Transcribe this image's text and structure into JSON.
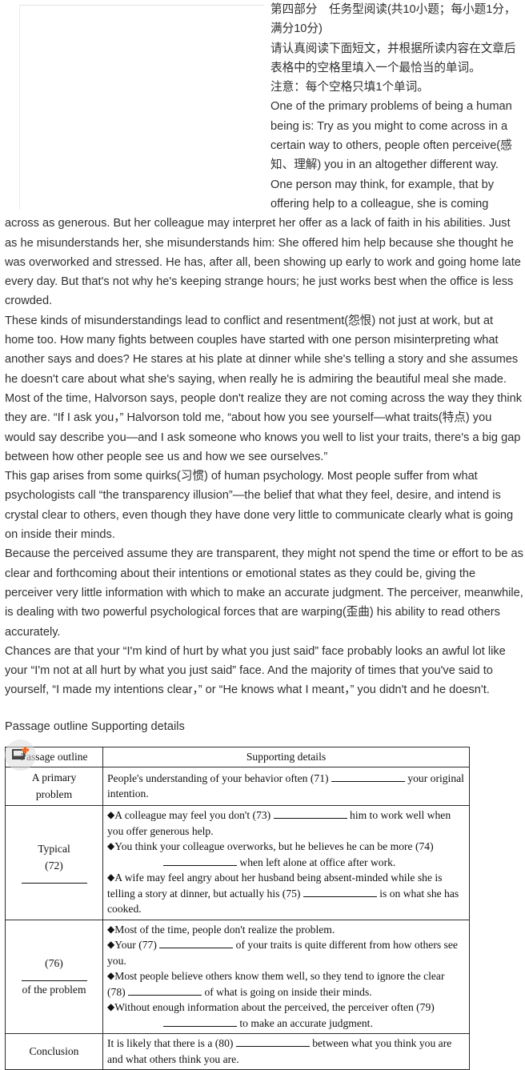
{
  "article": {
    "paragraphs": [
      "第四部分　任务型阅读(共10小题；每小题1分，满分10分)",
      "请认真阅读下面短文，并根据所读内容在文章后表格中的空格里填入一个最恰当的单词。",
      "注意：每个空格只填1个单词。",
      "One of the primary problems of being a human being is: Try as you might to come across in a certain way to others, people often perceive(感知、理解) you in an altogether different way.",
      "One person may think, for example, that by offering help to a colleague, she is coming across as generous. But her colleague may interpret her offer as a lack of faith in his abilities. Just as he misunderstands her, she misunderstands him: She offered him help because she thought he was overworked and stressed. He has, after all, been showing up early to work and going home late every day. But that's not why he's keeping strange hours; he just works best when the office is less crowded.",
      "These kinds of misunderstandings lead to conflict and resentment(怨恨) not just at work, but at home too. How many fights between couples have started with one person misinterpreting what another says and does? He stares at his plate at dinner while she's telling a story and she assumes he doesn't care about what she's saying, when really he is admiring the beautiful meal she made.",
      "Most of the time, Halvorson says, people don't realize they are not coming across the way they think they are. “If I ask you，” Halvorson told me, “about how you see yourself—what traits(特点) you would say describe you—and I ask someone who knows you well to list your traits, there's a big gap between how other people see us and how we see ourselves.”",
      "This gap arises from some quirks(习惯) of human psychology. Most people suffer from what psychologists call “the transparency illusion”—the belief that what they feel, desire, and intend is crystal clear to others, even though they have done very little to communicate clearly what is going on inside their minds.",
      "Because the perceived assume they are transparent, they might not spend the time or effort to be as clear and forthcoming about their intentions or emotional states as they could be, giving the perceiver very little information with which to make an accurate judgment. The perceiver, meanwhile, is dealing with two powerful psychological forces that are warping(歪曲) his ability to read others accurately.",
      "Chances are that your “I'm kind of hurt by what you just said” face probably looks an awful lot like your “I'm not at all hurt by what you just said” face. And the majority of times that you've said to yourself, “I made my intentions clear，” or “He knows what I meant，” you didn't and he doesn't."
    ],
    "caption": "Passage outline Supporting details"
  },
  "table": {
    "headers": [
      "Passage outline",
      "Supporting details"
    ],
    "rows": [
      {
        "outline_lines": [
          "A primary",
          "problem"
        ],
        "outline_blank": false,
        "details": [
          {
            "bullet": false,
            "segments": [
              {
                "type": "text",
                "value": "People's understanding of your behavior often (71)"
              },
              {
                "type": "blank",
                "width": "w1"
              },
              {
                "type": "text",
                "value": "your original intention."
              }
            ]
          }
        ]
      },
      {
        "outline_lines": [
          "Typical",
          "(72)"
        ],
        "outline_blank": true,
        "details": [
          {
            "bullet": true,
            "segments": [
              {
                "type": "text",
                "value": "A colleague may feel you don't (73)"
              },
              {
                "type": "blank",
                "width": "w1"
              },
              {
                "type": "text",
                "value": "him to work well when you offer generous help."
              }
            ]
          },
          {
            "bullet": true,
            "segments": [
              {
                "type": "text",
                "value": "You think your colleague overworks, but he believes he can be more (74)"
              },
              {
                "type": "indent",
                "value": ""
              },
              {
                "type": "blank",
                "width": "w1"
              },
              {
                "type": "text",
                "value": "when left alone at office after work."
              }
            ]
          },
          {
            "bullet": true,
            "segments": [
              {
                "type": "text",
                "value": "A wife may feel angry about her husband being absent-minded while she is telling a story at dinner, but actually his (75)"
              },
              {
                "type": "blank",
                "width": "w1"
              },
              {
                "type": "text",
                "value": "is on what she has cooked."
              }
            ]
          }
        ]
      },
      {
        "outline_lines": [
          "(76)",
          "of the problem"
        ],
        "outline_blank": true,
        "details": [
          {
            "bullet": true,
            "segments": [
              {
                "type": "text",
                "value": "Most of the time, people don't realize the problem."
              }
            ]
          },
          {
            "bullet": true,
            "segments": [
              {
                "type": "text",
                "value": "Your (77)"
              },
              {
                "type": "blank",
                "width": "w1"
              },
              {
                "type": "text",
                "value": "of your traits is quite different from how others see you."
              }
            ]
          },
          {
            "bullet": true,
            "segments": [
              {
                "type": "text",
                "value": "Most people believe others know them well, so they tend to ignore the clear (78)"
              },
              {
                "type": "blank",
                "width": "w1"
              },
              {
                "type": "text",
                "value": "of what is going on inside their minds."
              }
            ]
          },
          {
            "bullet": true,
            "segments": [
              {
                "type": "text",
                "value": "Without enough information about the perceived, the perceiver often (79)"
              },
              {
                "type": "indent",
                "value": ""
              },
              {
                "type": "blank",
                "width": "w1"
              },
              {
                "type": "text",
                "value": "to make an accurate judgment."
              }
            ]
          }
        ]
      },
      {
        "outline_lines": [
          "Conclusion"
        ],
        "outline_blank": false,
        "details": [
          {
            "bullet": false,
            "segments": [
              {
                "type": "text",
                "value": "It is likely that there is a (80)"
              },
              {
                "type": "blank",
                "width": "w1"
              },
              {
                "type": "text",
                "value": "between what you think you are and what others think you are."
              }
            ]
          }
        ]
      }
    ],
    "bullet_glyph": "◆"
  },
  "overlay": {
    "icon_name": "add-image-icon",
    "accent_color": "#f26522"
  }
}
